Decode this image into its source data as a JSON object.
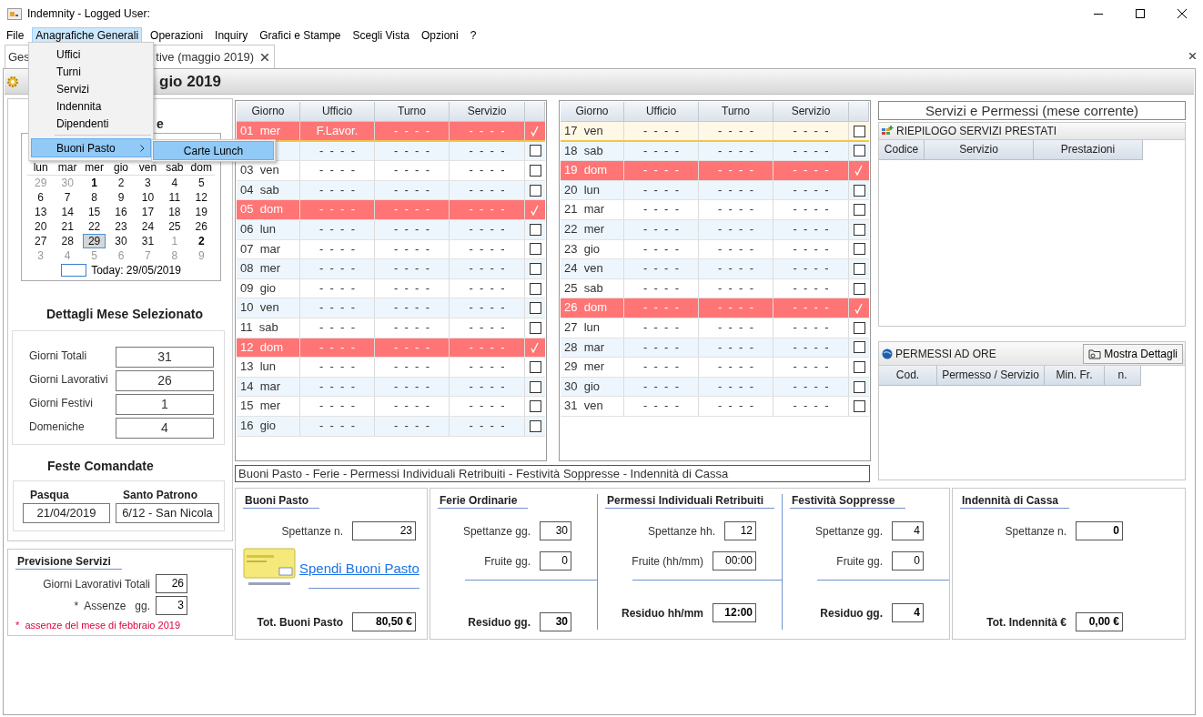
{
  "window": {
    "title": "Indemnity - Logged User:"
  },
  "menu": [
    {
      "label": "File",
      "selected": false
    },
    {
      "label": "Anagrafiche Generali",
      "selected": true
    },
    {
      "label": "Operazioni",
      "selected": false
    },
    {
      "label": "Inquiry",
      "selected": false
    },
    {
      "label": "Grafici e Stampe",
      "selected": false
    },
    {
      "label": "Scegli Vista",
      "selected": false
    },
    {
      "label": "Opzioni",
      "selected": false
    },
    {
      "label": "?",
      "selected": false
    }
  ],
  "menu_dropdown": {
    "items": [
      {
        "kind": "item",
        "label": "Uffici",
        "selected": false
      },
      {
        "kind": "item",
        "label": "Turni",
        "selected": false
      },
      {
        "kind": "item",
        "label": "Servizi",
        "selected": false
      },
      {
        "kind": "item",
        "label": "Indennita",
        "selected": false
      },
      {
        "kind": "item",
        "label": "Dipendenti",
        "selected": false
      },
      {
        "kind": "separator"
      },
      {
        "kind": "submenu",
        "label": "Buoni Pasto",
        "selected": true
      }
    ],
    "submenu": [
      {
        "label": "Carte Lunch",
        "selected": true
      }
    ]
  },
  "tab": {
    "label_start": "Ges",
    "label_end": "tive (maggio 2019)"
  },
  "header": {
    "title_end": "gio 2019"
  },
  "calendar": {
    "title_end": "e",
    "weekdays": [
      "lun",
      "mar",
      "mer",
      "gio",
      "ven",
      "sab",
      "dom"
    ],
    "weeks": [
      [
        {
          "text": "29",
          "other_month": true,
          "holiday": false,
          "selected": false
        },
        {
          "text": "30",
          "other_month": true,
          "holiday": false,
          "selected": false
        },
        {
          "text": "1",
          "other_month": false,
          "holiday": true,
          "selected": false
        },
        {
          "text": "2",
          "other_month": false,
          "holiday": false,
          "selected": false
        },
        {
          "text": "3",
          "other_month": false,
          "holiday": false,
          "selected": false
        },
        {
          "text": "4",
          "other_month": false,
          "holiday": false,
          "selected": false
        },
        {
          "text": "5",
          "other_month": false,
          "holiday": false,
          "selected": false
        }
      ],
      [
        {
          "text": "6",
          "other_month": false,
          "holiday": false,
          "selected": false
        },
        {
          "text": "7",
          "other_month": false,
          "holiday": false,
          "selected": false
        },
        {
          "text": "8",
          "other_month": false,
          "holiday": false,
          "selected": false
        },
        {
          "text": "9",
          "other_month": false,
          "holiday": false,
          "selected": false
        },
        {
          "text": "10",
          "other_month": false,
          "holiday": false,
          "selected": false
        },
        {
          "text": "11",
          "other_month": false,
          "holiday": false,
          "selected": false
        },
        {
          "text": "12",
          "other_month": false,
          "holiday": false,
          "selected": false
        }
      ],
      [
        {
          "text": "13",
          "other_month": false,
          "holiday": false,
          "selected": false
        },
        {
          "text": "14",
          "other_month": false,
          "holiday": false,
          "selected": false
        },
        {
          "text": "15",
          "other_month": false,
          "holiday": false,
          "selected": false
        },
        {
          "text": "16",
          "other_month": false,
          "holiday": false,
          "selected": false
        },
        {
          "text": "17",
          "other_month": false,
          "holiday": false,
          "selected": false
        },
        {
          "text": "18",
          "other_month": false,
          "holiday": false,
          "selected": false
        },
        {
          "text": "19",
          "other_month": false,
          "holiday": false,
          "selected": false
        }
      ],
      [
        {
          "text": "20",
          "other_month": false,
          "holiday": false,
          "selected": false
        },
        {
          "text": "21",
          "other_month": false,
          "holiday": false,
          "selected": false
        },
        {
          "text": "22",
          "other_month": false,
          "holiday": false,
          "selected": false
        },
        {
          "text": "23",
          "other_month": false,
          "holiday": false,
          "selected": false
        },
        {
          "text": "24",
          "other_month": false,
          "holiday": false,
          "selected": false
        },
        {
          "text": "25",
          "other_month": false,
          "holiday": false,
          "selected": false
        },
        {
          "text": "26",
          "other_month": false,
          "holiday": false,
          "selected": false
        }
      ],
      [
        {
          "text": "27",
          "other_month": false,
          "holiday": false,
          "selected": false
        },
        {
          "text": "28",
          "other_month": false,
          "holiday": false,
          "selected": false
        },
        {
          "text": "29",
          "other_month": false,
          "holiday": false,
          "selected": true
        },
        {
          "text": "30",
          "other_month": false,
          "holiday": false,
          "selected": false
        },
        {
          "text": "31",
          "other_month": false,
          "holiday": false,
          "selected": false
        },
        {
          "text": "1",
          "other_month": true,
          "holiday": false,
          "selected": false
        },
        {
          "text": "2",
          "other_month": true,
          "holiday": true,
          "selected": false
        }
      ],
      [
        {
          "text": "3",
          "other_month": true,
          "holiday": false,
          "selected": false
        },
        {
          "text": "4",
          "other_month": true,
          "holiday": false,
          "selected": false
        },
        {
          "text": "5",
          "other_month": true,
          "holiday": false,
          "selected": false
        },
        {
          "text": "6",
          "other_month": true,
          "holiday": false,
          "selected": false
        },
        {
          "text": "7",
          "other_month": true,
          "holiday": false,
          "selected": false
        },
        {
          "text": "8",
          "other_month": true,
          "holiday": false,
          "selected": false
        },
        {
          "text": "9",
          "other_month": true,
          "holiday": false,
          "selected": false
        }
      ]
    ],
    "today": "Today: 29/05/2019"
  },
  "month_details": {
    "title": "Dettagli Mese Selezionato",
    "rows": [
      {
        "label": "Giorni Totali",
        "value": "31"
      },
      {
        "label": "Giorni Lavorativi",
        "value": "26"
      },
      {
        "label": "Giorni Festivi",
        "value": "1"
      },
      {
        "label": "Domeniche",
        "value": "4"
      }
    ]
  },
  "holidays": {
    "title": "Feste Comandate",
    "fields": [
      {
        "label": "Pasqua",
        "value": "21/04/2019"
      },
      {
        "label": "Santo Patrono",
        "value": "6/12 - San Nicola"
      }
    ]
  },
  "forecast": {
    "title": "Previsione Servizi",
    "rows": [
      {
        "label": "Giorni Lavorativi Totali",
        "value": "26"
      },
      {
        "label": "*  Assenze   gg.",
        "value": "3"
      }
    ],
    "note": "*  assenze del mese di febbraio 2019"
  },
  "day_tables": [
    {
      "columns": [
        "Giorno",
        "Ufficio",
        "Turno",
        "Servizio"
      ],
      "rows": [
        {
          "day": "01  mer",
          "office": "F.Lavor.",
          "shift": "-  -  -  -",
          "service": "-  -  -  -",
          "holiday": true,
          "checked": true,
          "selected": true
        },
        {
          "office": "-  -  -  -",
          "shift": "-  -  -  -",
          "service": "-  -  -  -",
          "holiday": false,
          "checked": false,
          "selected": false
        },
        {
          "day": "03  ven",
          "office": "-  -  -  -",
          "shift": "-  -  -  -",
          "service": "-  -  -  -",
          "holiday": false,
          "checked": false,
          "selected": false
        },
        {
          "day": "04  sab",
          "office": "-  -  -  -",
          "shift": "-  -  -  -",
          "service": "-  -  -  -",
          "holiday": false,
          "checked": false,
          "selected": false
        },
        {
          "day": "05  dom",
          "office": "-  -  -  -",
          "shift": "-  -  -  -",
          "service": "-  -  -  -",
          "holiday": true,
          "checked": true,
          "selected": false
        },
        {
          "day": "06  lun",
          "office": "-  -  -  -",
          "shift": "-  -  -  -",
          "service": "-  -  -  -",
          "holiday": false,
          "checked": false,
          "selected": false
        },
        {
          "day": "07  mar",
          "office": "-  -  -  -",
          "shift": "-  -  -  -",
          "service": "-  -  -  -",
          "holiday": false,
          "checked": false,
          "selected": false
        },
        {
          "day": "08  mer",
          "office": "-  -  -  -",
          "shift": "-  -  -  -",
          "service": "-  -  -  -",
          "holiday": false,
          "checked": false,
          "selected": false
        },
        {
          "day": "09  gio",
          "office": "-  -  -  -",
          "shift": "-  -  -  -",
          "service": "-  -  -  -",
          "holiday": false,
          "checked": false,
          "selected": false
        },
        {
          "day": "10  ven",
          "office": "-  -  -  -",
          "shift": "-  -  -  -",
          "service": "-  -  -  -",
          "holiday": false,
          "checked": false,
          "selected": false
        },
        {
          "day": "11  sab",
          "office": "-  -  -  -",
          "shift": "-  -  -  -",
          "service": "-  -  -  -",
          "holiday": false,
          "checked": false,
          "selected": false
        },
        {
          "day": "12  dom",
          "office": "-  -  -  -",
          "shift": "-  -  -  -",
          "service": "-  -  -  -",
          "holiday": true,
          "checked": true,
          "selected": false
        },
        {
          "day": "13  lun",
          "office": "-  -  -  -",
          "shift": "-  -  -  -",
          "service": "-  -  -  -",
          "holiday": false,
          "checked": false,
          "selected": false
        },
        {
          "day": "14  mar",
          "office": "-  -  -  -",
          "shift": "-  -  -  -",
          "service": "-  -  -  -",
          "holiday": false,
          "checked": false,
          "selected": false
        },
        {
          "day": "15  mer",
          "office": "-  -  -  -",
          "shift": "-  -  -  -",
          "service": "-  -  -  -",
          "holiday": false,
          "checked": false,
          "selected": false
        },
        {
          "day": "16  gio",
          "office": "-  -  -  -",
          "shift": "-  -  -  -",
          "service": "-  -  -  -",
          "holiday": false,
          "checked": false,
          "selected": false
        }
      ]
    },
    {
      "columns": [
        "Giorno",
        "Ufficio",
        "Turno",
        "Servizio"
      ],
      "rows": [
        {
          "day": "17  ven",
          "office": "-  -  -  -",
          "shift": "-  -  -  -",
          "service": "-  -  -  -",
          "holiday": false,
          "checked": false,
          "selected": true
        },
        {
          "day": "18  sab",
          "office": "-  -  -  -",
          "shift": "-  -  -  -",
          "service": "-  -  -  -",
          "holiday": false,
          "checked": false,
          "selected": false
        },
        {
          "day": "19  dom",
          "office": "-  -  -  -",
          "shift": "-  -  -  -",
          "service": "-  -  -  -",
          "holiday": true,
          "checked": true,
          "selected": false
        },
        {
          "day": "20  lun",
          "office": "-  -  -  -",
          "shift": "-  -  -  -",
          "service": "-  -  -  -",
          "holiday": false,
          "checked": false,
          "selected": false
        },
        {
          "day": "21  mar",
          "office": "-  -  -  -",
          "shift": "-  -  -  -",
          "service": "-  -  -  -",
          "holiday": false,
          "checked": false,
          "selected": false
        },
        {
          "day": "22  mer",
          "office": "-  -  -  -",
          "shift": "-  -  -  -",
          "service": "-  -  -  -",
          "holiday": false,
          "checked": false,
          "selected": false
        },
        {
          "day": "23  gio",
          "office": "-  -  -  -",
          "shift": "-  -  -  -",
          "service": "-  -  -  -",
          "holiday": false,
          "checked": false,
          "selected": false
        },
        {
          "day": "24  ven",
          "office": "-  -  -  -",
          "shift": "-  -  -  -",
          "service": "-  -  -  -",
          "holiday": false,
          "checked": false,
          "selected": false
        },
        {
          "day": "25  sab",
          "office": "-  -  -  -",
          "shift": "-  -  -  -",
          "service": "-  -  -  -",
          "holiday": false,
          "checked": false,
          "selected": false
        },
        {
          "day": "26  dom",
          "office": "-  -  -  -",
          "shift": "-  -  -  -",
          "service": "-  -  -  -",
          "holiday": true,
          "checked": true,
          "selected": false
        },
        {
          "day": "27  lun",
          "office": "-  -  -  -",
          "shift": "-  -  -  -",
          "service": "-  -  -  -",
          "holiday": false,
          "checked": false,
          "selected": false
        },
        {
          "day": "28  mar",
          "office": "-  -  -  -",
          "shift": "-  -  -  -",
          "service": "-  -  -  -",
          "holiday": false,
          "checked": false,
          "selected": false
        },
        {
          "day": "29  mer",
          "office": "-  -  -  -",
          "shift": "-  -  -  -",
          "service": "-  -  -  -",
          "holiday": false,
          "checked": false,
          "selected": false
        },
        {
          "day": "30  gio",
          "office": "-  -  -  -",
          "shift": "-  -  -  -",
          "service": "-  -  -  -",
          "holiday": false,
          "checked": false,
          "selected": false
        },
        {
          "day": "31  ven",
          "office": "-  -  -  -",
          "shift": "-  -  -  -",
          "service": "-  -  -  -",
          "holiday": false,
          "checked": false,
          "selected": false
        }
      ]
    }
  ],
  "caption": "Buoni Pasto - Ferie - Permessi Individuali Retribuiti - Festività Soppresse - Indennità di Cassa",
  "summary": {
    "title": "Servizi  e  Permessi (mese corrente)",
    "services": {
      "title": "RIEPILOGO SERVIZI PRESTATI",
      "columns": [
        "Codice",
        "Servizio",
        "Prestazioni"
      ]
    },
    "permits": {
      "title": "PERMESSI AD ORE",
      "button": "Mostra Dettagli",
      "columns": [
        "Cod.",
        "Permesso / Servizio",
        "Min. Fr.",
        "n."
      ]
    }
  },
  "bottom_panels": [
    {
      "kind": "vouchers",
      "title": "Buoni Pasto",
      "fields": [
        {
          "label": "Spettanze n.",
          "value": "23",
          "bold": false
        }
      ],
      "link": "Spendi Buoni Pasto",
      "total": {
        "label": "Tot. Buoni Pasto",
        "value": "80,50 €"
      }
    },
    {
      "kind": "group",
      "sections": [
        {
          "title": "Ferie Ordinarie",
          "fields": [
            {
              "label": "Spettanze gg.",
              "value": "30",
              "bold": false
            },
            {
              "label": "Fruite gg.",
              "value": "0",
              "bold": false
            }
          ],
          "total": {
            "label": "Residuo gg.",
            "value": "30"
          }
        },
        {
          "title": "Permessi Individuali Retribuiti",
          "fields": [
            {
              "label": "Spettanze hh.",
              "value": "12",
              "bold": false
            },
            {
              "label": "Fruite (hh/mm)",
              "value": "00:00",
              "bold": false
            }
          ],
          "total": {
            "label": "Residuo hh/mm",
            "value": "12:00"
          }
        },
        {
          "title": "Festività Soppresse",
          "fields": [
            {
              "label": "Spettanze gg.",
              "value": "4",
              "bold": false
            },
            {
              "label": "Fruite gg.",
              "value": "0",
              "bold": false
            }
          ],
          "total": {
            "label": "Residuo gg.",
            "value": "4"
          }
        }
      ]
    },
    {
      "kind": "plain",
      "title": "Indennità di  Cassa",
      "fields": [
        {
          "label": "Spettanze n.",
          "value": "0",
          "bold": true
        }
      ],
      "total": {
        "label": "Tot. Indennità €",
        "value": "0,00 €"
      }
    }
  ]
}
